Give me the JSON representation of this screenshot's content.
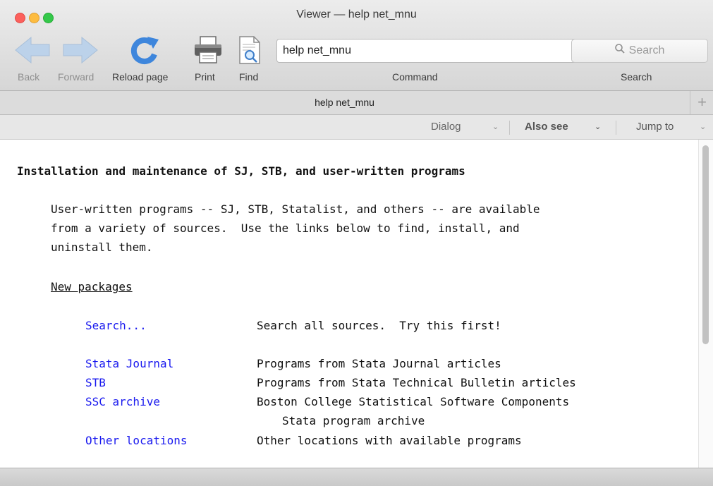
{
  "window": {
    "title": "Viewer — help net_mnu"
  },
  "toolbar": {
    "back_label": "Back",
    "forward_label": "Forward",
    "reload_label": "Reload page",
    "print_label": "Print",
    "find_label": "Find",
    "command_value": "help net_mnu",
    "command_label": "Command",
    "search_placeholder": "Search",
    "search_label": "Search"
  },
  "tabs": {
    "active_label": "help net_mnu",
    "add_symbol": "+"
  },
  "navbar": {
    "dialog_label": "Dialog",
    "also_see_label": "Also see",
    "jump_to_label": "Jump to"
  },
  "content": {
    "heading": "Installation and maintenance of SJ, STB, and user-written programs",
    "intro": [
      "User-written programs -- SJ, STB, Statalist, and others -- are available",
      "from a variety of sources.  Use the links below to find, install, and",
      "uninstall them."
    ],
    "section_title": "New packages",
    "entries": [
      {
        "link": "Search...",
        "desc": "Search all sources.  Try this first!"
      },
      {
        "link": "Stata Journal",
        "desc": "Programs from Stata Journal articles"
      },
      {
        "link": "STB",
        "desc": "Programs from Stata Technical Bulletin articles"
      },
      {
        "link": "SSC archive",
        "desc": "Boston College Statistical Software Components",
        "desc2": "Stata program archive"
      },
      {
        "link": "Other locations",
        "desc": "Other locations with available programs"
      }
    ]
  },
  "colors": {
    "link": "#1a1aef",
    "toolbar_icon_blue": "#4d8fe0"
  },
  "icons": {
    "back": "back-arrow-icon",
    "forward": "forward-arrow-icon",
    "reload": "reload-icon",
    "print": "printer-icon",
    "find": "find-document-icon",
    "search": "magnifier-icon"
  }
}
